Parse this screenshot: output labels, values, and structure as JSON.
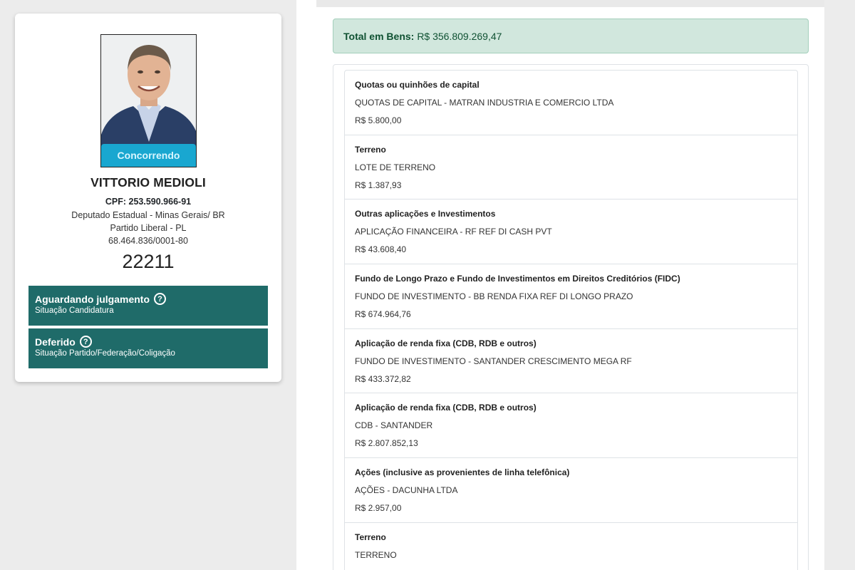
{
  "candidate": {
    "status_pill": "Concorrendo",
    "name": "VITTORIO MEDIOLI",
    "cpf": "CPF: 253.590.966-91",
    "office": "Deputado Estadual - Minas Gerais/ BR",
    "party": "Partido Liberal - PL",
    "cnpj": "68.464.836/0001-80",
    "number": "22211",
    "situations": [
      {
        "title": "Aguardando julgamento",
        "subtitle": "Situação Candidatura"
      },
      {
        "title": "Deferido",
        "subtitle": "Situação Partido/Federação/Coligação"
      }
    ]
  },
  "assets": {
    "total_label": "Total em Bens:",
    "total_value": "R$ 356.809.269,47",
    "items": [
      {
        "title": "Quotas ou quinhões de capital",
        "desc": "QUOTAS DE CAPITAL - MATRAN INDUSTRIA E COMERCIO LTDA",
        "value": "R$ 5.800,00"
      },
      {
        "title": "Terreno",
        "desc": "LOTE DE TERRENO",
        "value": "R$ 1.387,93"
      },
      {
        "title": "Outras aplicações e Investimentos",
        "desc": "APLICAÇÃO FINANCEIRA - RF REF DI CASH PVT",
        "value": "R$ 43.608,40"
      },
      {
        "title": "Fundo de Longo Prazo e Fundo de Investimentos em Direitos Creditórios (FIDC)",
        "desc": "FUNDO DE INVESTIMENTO - BB RENDA FIXA REF DI LONGO PRAZO",
        "value": "R$ 674.964,76"
      },
      {
        "title": "Aplicação de renda fixa (CDB, RDB e outros)",
        "desc": "FUNDO DE INVESTIMENTO - SANTANDER CRESCIMENTO MEGA RF",
        "value": "R$ 433.372,82"
      },
      {
        "title": "Aplicação de renda fixa (CDB, RDB e outros)",
        "desc": "CDB - SANTANDER",
        "value": "R$ 2.807.852,13"
      },
      {
        "title": "Ações (inclusive as provenientes de linha telefônica)",
        "desc": "AÇÕES - DACUNHA LTDA",
        "value": "R$ 2.957,00"
      },
      {
        "title": "Terreno",
        "desc": "TERRENO",
        "value": ""
      }
    ]
  },
  "icons": {
    "help": "question-circle-icon"
  },
  "colors": {
    "situation_bg": "#1f6b69",
    "pill_bg": "#17b2dc",
    "total_bg": "#d1e7dd",
    "total_text": "#0f5132"
  }
}
